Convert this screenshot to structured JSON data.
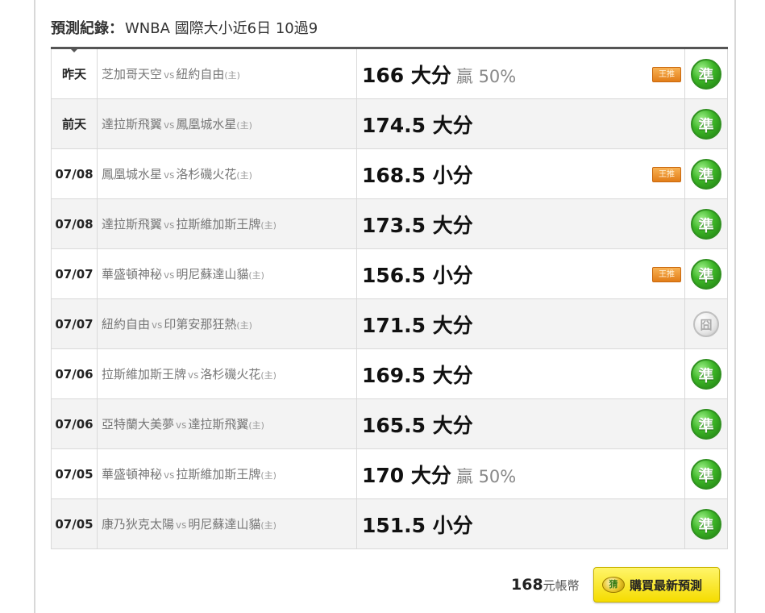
{
  "header": {
    "label": "預測紀錄",
    "colon": "：",
    "subtitle": "WNBA 國際大小近6日 10過9"
  },
  "icons": {
    "pick_badge": "王推",
    "hit_stamp": "準",
    "miss_stamp": "囧",
    "coin_icon_text": "猜"
  },
  "colors": {
    "hit": "#3cb526",
    "miss": "#bdbdbd",
    "badge": "#e27d18",
    "buy_button": "#f5dc00"
  },
  "rows": [
    {
      "date": "昨天",
      "away": "芝加哥天空",
      "vs": "vs",
      "home": "紐約自由",
      "home_mark": "(主)",
      "pred": "166 大分",
      "win": "贏 50%",
      "badge": true,
      "result": "hit"
    },
    {
      "date": "前天",
      "away": "達拉斯飛翼",
      "vs": "vs",
      "home": "鳳凰城水星",
      "home_mark": "(主)",
      "pred": "174.5 大分",
      "win": "",
      "badge": false,
      "result": "hit"
    },
    {
      "date": "07/08",
      "away": "鳳凰城水星",
      "vs": "vs",
      "home": "洛杉磯火花",
      "home_mark": "(主)",
      "pred": "168.5 小分",
      "win": "",
      "badge": true,
      "result": "hit"
    },
    {
      "date": "07/08",
      "away": "達拉斯飛翼",
      "vs": "vs",
      "home": "拉斯維加斯王牌",
      "home_mark": "(主)",
      "pred": "173.5 大分",
      "win": "",
      "badge": false,
      "result": "hit"
    },
    {
      "date": "07/07",
      "away": "華盛頓神秘",
      "vs": "vs",
      "home": "明尼蘇達山貓",
      "home_mark": "(主)",
      "pred": "156.5 小分",
      "win": "",
      "badge": true,
      "result": "hit"
    },
    {
      "date": "07/07",
      "away": "紐約自由",
      "vs": "vs",
      "home": "印第安那狂熱",
      "home_mark": "(主)",
      "pred": "171.5 大分",
      "win": "",
      "badge": false,
      "result": "miss"
    },
    {
      "date": "07/06",
      "away": "拉斯維加斯王牌",
      "vs": "vs",
      "home": "洛杉磯火花",
      "home_mark": "(主)",
      "pred": "169.5 大分",
      "win": "",
      "badge": false,
      "result": "hit"
    },
    {
      "date": "07/06",
      "away": "亞特蘭大美夢",
      "vs": "vs",
      "home": "達拉斯飛翼",
      "home_mark": "(主)",
      "pred": "165.5 大分",
      "win": "",
      "badge": false,
      "result": "hit"
    },
    {
      "date": "07/05",
      "away": "華盛頓神秘",
      "vs": "vs",
      "home": "拉斯維加斯王牌",
      "home_mark": "(主)",
      "pred": "170 大分",
      "win": "贏 50%",
      "badge": false,
      "result": "hit"
    },
    {
      "date": "07/05",
      "away": "康乃狄克太陽",
      "vs": "vs",
      "home": "明尼蘇達山貓",
      "home_mark": "(主)",
      "pred": "151.5 小分",
      "win": "",
      "badge": false,
      "result": "hit"
    }
  ],
  "footer": {
    "price": "168",
    "unit": "元帳幣",
    "buy_label": "購買最新預測"
  }
}
